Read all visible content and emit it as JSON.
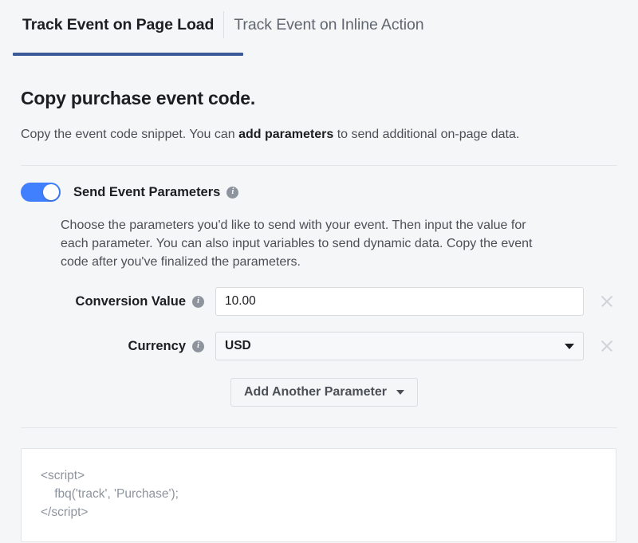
{
  "tabs": [
    {
      "label": "Track Event on Page Load",
      "active": true
    },
    {
      "label": "Track Event on Inline Action",
      "active": false
    }
  ],
  "header": {
    "title": "Copy purchase event code.",
    "description_before": "Copy the event code snippet. You can ",
    "description_bold": "add parameters",
    "description_after": " to send additional on-page data."
  },
  "parameters_section": {
    "toggle_label": "Send Event Parameters",
    "toggle_on": true,
    "info_icon_glyph": "i",
    "description": "Choose the parameters you'd like to send with your event. Then input the value for each parameter. You can also input variables to send dynamic data. Copy the event code after you've finalized the parameters.",
    "fields": [
      {
        "label": "Conversion Value",
        "type": "text",
        "value": "10.00",
        "placeholder": ""
      },
      {
        "label": "Currency",
        "type": "select",
        "value": "USD"
      }
    ],
    "add_button_label": "Add Another Parameter"
  },
  "code_snippet": "<script>\n    fbq('track', 'Purchase');\n</script>",
  "colors": {
    "page_background": "#f5f6f7",
    "tab_underline": "#3b5998",
    "toggle_on": "#4080ff",
    "text_primary": "#1c1e21",
    "text_secondary": "#4b4f56",
    "code_text": "#8d949e",
    "divider": "#e3e5e8"
  }
}
